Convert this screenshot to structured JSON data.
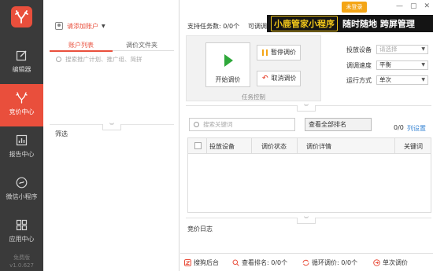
{
  "sidebar": {
    "items": [
      {
        "label": "编辑器",
        "icon": "edit-icon"
      },
      {
        "label": "竞价中心",
        "icon": "antler-icon"
      },
      {
        "label": "报告中心",
        "icon": "report-icon"
      },
      {
        "label": "微信小程序",
        "icon": "miniprogram-icon"
      },
      {
        "label": "应用中心",
        "icon": "apps-icon"
      }
    ],
    "edition": "免费版",
    "version": "v1.0.627"
  },
  "account": {
    "placeholder": "请添加账户",
    "tabs": [
      "账户列表",
      "调价文件夹"
    ],
    "search_placeholder": "搜索推广计划、推广组、简拼",
    "filter_label": "筛选"
  },
  "header": {
    "tasks_supported": "支持任务数: 0/0个",
    "adjustable": "可调调",
    "login_badge": "未登录",
    "banner_brand": "小鹿管家小程序",
    "banner_slogan": "随时随地  跨屏管理",
    "window_buttons": [
      "—",
      "▢",
      "✕"
    ]
  },
  "task_control": {
    "start_label": "开始调价",
    "pause_label": "暂停调价",
    "cancel_label": "取消调价",
    "group_label": "任务控制"
  },
  "settings": [
    {
      "key": "投放设备",
      "value": "请选择",
      "disabled": true
    },
    {
      "key": "调调速度",
      "value": "平衡",
      "disabled": false
    },
    {
      "key": "运行方式",
      "value": "单次",
      "disabled": false
    }
  ],
  "keywords": {
    "search_placeholder": "搜索关键词",
    "rank_button": "查看全部排名",
    "count": "0/0",
    "col_settings": "列设置",
    "columns": [
      "投放设备",
      "调价状态",
      "调价详情",
      "关键词"
    ]
  },
  "log": {
    "label": "竞价日志"
  },
  "status": [
    {
      "label": "搜狗后台",
      "icon": "sogou-icon",
      "color": "#e94f3c"
    },
    {
      "label": "查看排名: 0/0个",
      "icon": "search-icon",
      "color": "#e94f3c"
    },
    {
      "label": "循环调价: 0/0个",
      "icon": "loop-icon",
      "color": "#e94f3c"
    },
    {
      "label": "单次调价",
      "icon": "single-icon",
      "color": "#e94f3c"
    }
  ],
  "colors": {
    "accent": "#e94f3c",
    "sidebar": "#3a3a3a",
    "play": "#2ea83a",
    "link": "#3a86d4"
  }
}
